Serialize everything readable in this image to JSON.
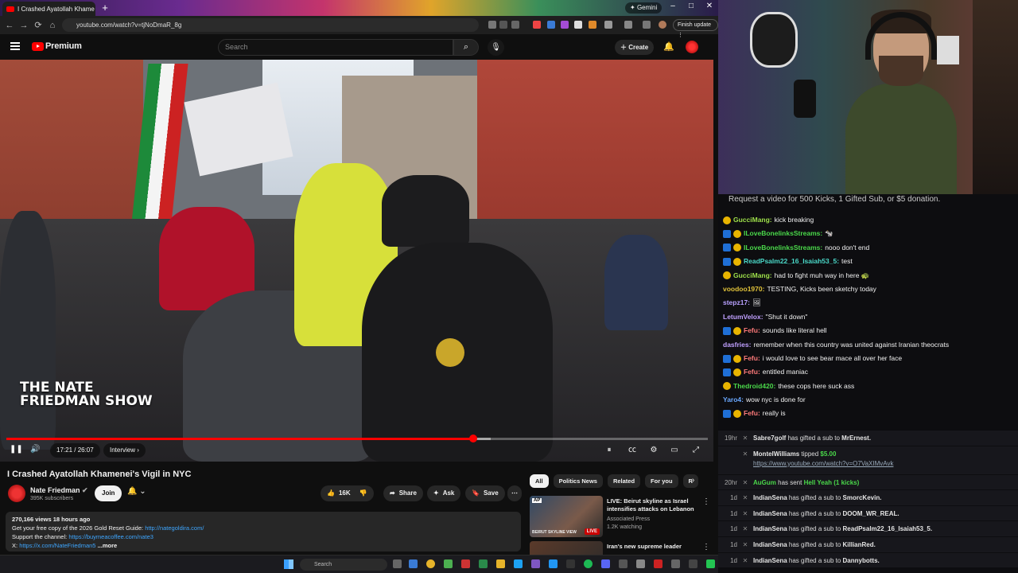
{
  "browser": {
    "tab_title": "I Crashed Ayatollah Khame",
    "gemini_label": "Gemini",
    "url": "youtube.com/watch?v=tjNoDmaR_8g",
    "finish_update": "Finish update"
  },
  "youtube": {
    "brand": "Premium",
    "search_placeholder": "Search",
    "create_label": "Create"
  },
  "video": {
    "overlay_title": "THE NATE FRIEDMAN SHOW",
    "time_current": "17:21",
    "time_total": "26:07",
    "time_display": "17:21 / 26:07",
    "chapter": "Interview",
    "progress": 0.665,
    "buffered": 0.69
  },
  "info": {
    "title": "I Crashed Ayatollah Khamenei's Vigil in NYC",
    "channel": "Nate Friedman",
    "subscribers": "395K subscribers",
    "join": "Join",
    "likes": "16K",
    "share": "Share",
    "ask": "Ask",
    "save": "Save",
    "views_time": "270,166 views  18 hours ago",
    "desc_line1": "Get your free copy of the 2026 Gold Reset Guide:",
    "desc_link1": "http://nategoldira.com/",
    "desc_line2": "Support the channel:",
    "desc_link2": "https://buymeacoffee.com/nate3",
    "desc_line3": "X:",
    "desc_link3": "https://x.com/NateFriedman5",
    "more": "...more"
  },
  "sidebar": {
    "chips": [
      "All",
      "Politics News",
      "Related",
      "For you",
      "R"
    ],
    "recs": [
      {
        "title": "LIVE: Beirut skyline as Israel intensifies attacks on Lebanon",
        "channel": "Associated Press",
        "meta": "1.2K watching",
        "badge": "LIVE",
        "thumb_caption": "BEIRUT SKYLINE VIEW"
      },
      {
        "title": "Iran's new supreme leader"
      }
    ]
  },
  "stream": {
    "banner": "Request a video for 500 Kicks, 1 Gifted Sub, or $5 donation.",
    "chat": [
      {
        "user": "GucciMang:",
        "msg": "kick breaking",
        "color": "#9ddf4a",
        "badges": [
          "coin"
        ]
      },
      {
        "user": "ILoveBonelinksStreams:",
        "msg": "🐄",
        "color": "#4ad84a",
        "badges": [
          "blue",
          "coin"
        ]
      },
      {
        "user": "ILoveBonelinksStreams:",
        "msg": "nooo don't end",
        "color": "#4ad84a",
        "badges": [
          "blue",
          "coin"
        ]
      },
      {
        "user": "ReadPsalm22_16_Isaiah53_5:",
        "msg": "test",
        "color": "#4ad8c8",
        "badges": [
          "blue",
          "coin"
        ]
      },
      {
        "user": "GucciMang:",
        "msg": "had to fight muh way in here 🐢",
        "color": "#9ddf4a",
        "badges": [
          "coin"
        ]
      },
      {
        "user": "voodoo1970:",
        "msg": "TESTING, Kicks been sketchy today",
        "color": "#e0c23a",
        "badges": []
      },
      {
        "user": "stepz17:",
        "msg": "🖼",
        "color": "#b8a0ff",
        "badges": []
      },
      {
        "user": "LetumVelox:",
        "msg": "\"Shut it down\"",
        "color": "#c0a0ff",
        "badges": []
      },
      {
        "user": "Fefu:",
        "msg": "sounds like literal hell",
        "color": "#ff7a7a",
        "badges": [
          "blue",
          "coin"
        ]
      },
      {
        "user": "dasfries:",
        "msg": "remember when this country was united against Iranian theocrats",
        "color": "#c0a0ff",
        "badges": []
      },
      {
        "user": "Fefu:",
        "msg": "i would love to see bear mace all over her face",
        "color": "#ff7a7a",
        "badges": [
          "blue",
          "coin"
        ]
      },
      {
        "user": "Fefu:",
        "msg": "entitled maniac",
        "color": "#ff7a7a",
        "badges": [
          "blue",
          "coin"
        ]
      },
      {
        "user": "Thedroid420:",
        "msg": "these cops here suck ass",
        "color": "#4ad84a",
        "badges": [
          "coin"
        ]
      },
      {
        "user": "Yaro4:",
        "msg": "wow nyc is done for",
        "color": "#6aa8ff",
        "badges": []
      },
      {
        "user": "Fefu:",
        "msg": "really is",
        "color": "#ff7a7a",
        "badges": [
          "blue",
          "coin"
        ]
      }
    ],
    "events": [
      {
        "time": "19hr",
        "user": "Sabre7golf",
        "text": "has gifted a sub to",
        "target": "MrErnest."
      },
      {
        "time": "",
        "user": "MontelWilliams",
        "text": "tipped",
        "target": "$5.00",
        "link": "https://www.youtube.com/watch?v=O7VaXIMvAvk"
      },
      {
        "time": "20hr",
        "user": "AuGum",
        "text": "has sent",
        "target": "Hell Yeah (1 kicks)"
      },
      {
        "time": "1d",
        "user": "IndianSena",
        "text": "has gifted a sub to",
        "target": "SmorcKevin."
      },
      {
        "time": "1d",
        "user": "IndianSena",
        "text": "has gifted a sub to",
        "target": "DOOM_WR_REAL."
      },
      {
        "time": "1d",
        "user": "IndianSena",
        "text": "has gifted a sub to",
        "target": "ReadPsalm22_16_Isaiah53_5."
      },
      {
        "time": "1d",
        "user": "IndianSena",
        "text": "has gifted a sub to",
        "target": "KillianRed."
      },
      {
        "time": "1d",
        "user": "IndianSena",
        "text": "has gifted a sub to",
        "target": "Dannybotts."
      }
    ]
  },
  "taskbar": {
    "search_placeholder": "Search"
  }
}
